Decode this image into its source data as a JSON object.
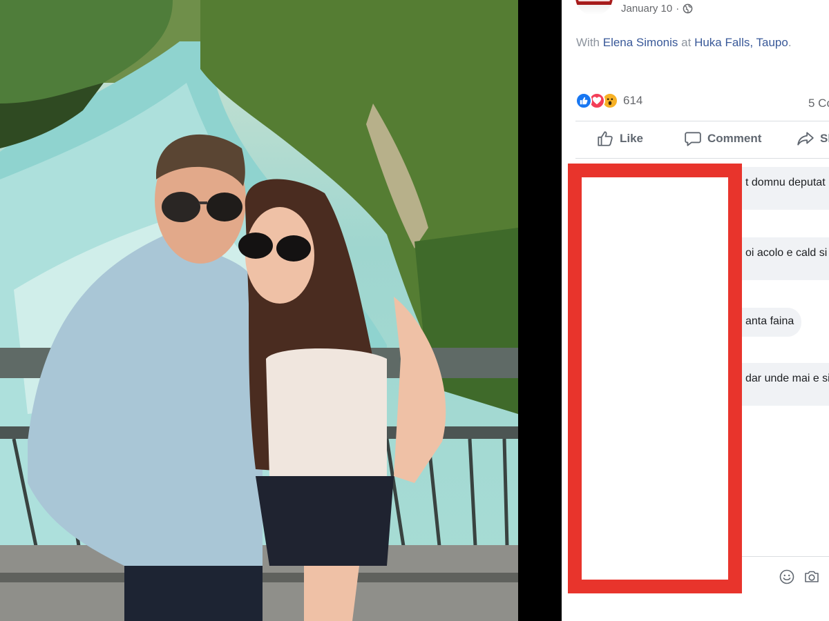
{
  "post": {
    "date": "January 10",
    "privacy_icon": "globe-icon",
    "with_prefix": "With",
    "tagged_person": "Elena Simonis",
    "at_word": "at",
    "location": "Huka Falls, Taupo",
    "location_suffix": "."
  },
  "reactions": {
    "icons": [
      "like-reaction-icon",
      "love-reaction-icon",
      "wow-reaction-icon"
    ],
    "count": "614",
    "comments_label": "5 Co"
  },
  "actions": {
    "like": "Like",
    "comment": "Comment",
    "share": "Sh"
  },
  "comments": [
    {
      "text": "t domnu deputat"
    },
    {
      "text": "oi acolo e cald si"
    },
    {
      "text": "anta faina"
    },
    {
      "text": "dar unde mai e si"
    }
  ],
  "composer": {
    "icons": [
      "emoji-icon",
      "camera-icon"
    ]
  },
  "colors": {
    "link": "#385898",
    "redaction": "#e8342c",
    "like_blue": "#1877f2",
    "love_red": "#f33e58",
    "wow_yellow": "#f7b125"
  }
}
